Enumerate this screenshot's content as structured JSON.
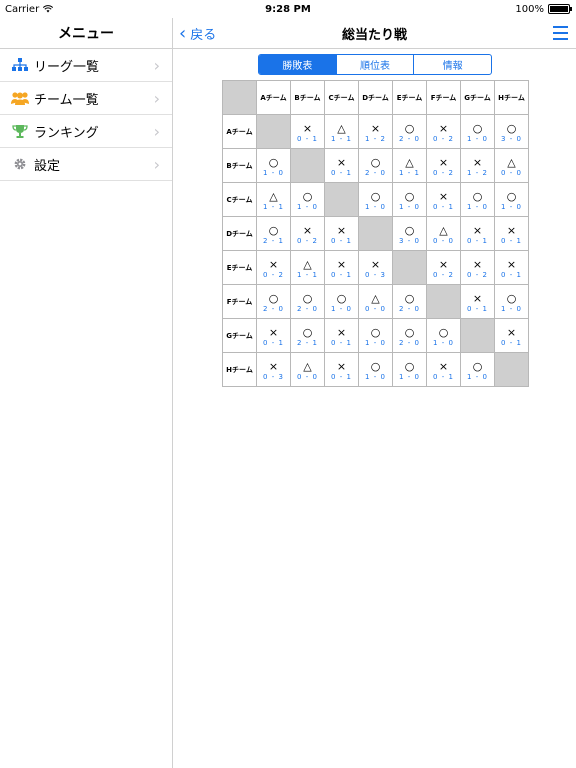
{
  "status_bar": {
    "carrier": "Carrier",
    "time": "9:28 PM",
    "battery": "100%"
  },
  "sidebar": {
    "title": "メニュー",
    "items": [
      {
        "label": "リーグ一覧",
        "icon": "hierarchy-icon",
        "color": "#1a73e8"
      },
      {
        "label": "チーム一覧",
        "icon": "people-icon",
        "color": "#f5a623"
      },
      {
        "label": "ランキング",
        "icon": "trophy-icon",
        "color": "#5cb85c"
      },
      {
        "label": "設定",
        "icon": "gear-icon",
        "color": "#8e8e93"
      }
    ]
  },
  "header": {
    "back_label": "戻る",
    "title": "総当たり戦"
  },
  "tabs": [
    {
      "label": "勝敗表",
      "active": true
    },
    {
      "label": "順位表",
      "active": false
    },
    {
      "label": "情報",
      "active": false
    }
  ],
  "teams": [
    "Aチーム",
    "Bチーム",
    "Cチーム",
    "Dチーム",
    "Eチーム",
    "Fチーム",
    "Gチーム",
    "Hチーム"
  ],
  "results": [
    [
      null,
      {
        "s": "×",
        "score": "0 - 1"
      },
      {
        "s": "△",
        "score": "1 - 1"
      },
      {
        "s": "×",
        "score": "1 - 2"
      },
      {
        "s": "○",
        "score": "2 - 0"
      },
      {
        "s": "×",
        "score": "0 - 2"
      },
      {
        "s": "○",
        "score": "1 - 0"
      },
      {
        "s": "○",
        "score": "3 - 0"
      }
    ],
    [
      {
        "s": "○",
        "score": "1 - 0"
      },
      null,
      {
        "s": "×",
        "score": "0 - 1"
      },
      {
        "s": "○",
        "score": "2 - 0"
      },
      {
        "s": "△",
        "score": "1 - 1"
      },
      {
        "s": "×",
        "score": "0 - 2"
      },
      {
        "s": "×",
        "score": "1 - 2"
      },
      {
        "s": "△",
        "score": "0 - 0"
      }
    ],
    [
      {
        "s": "△",
        "score": "1 - 1"
      },
      {
        "s": "○",
        "score": "1 - 0"
      },
      null,
      {
        "s": "○",
        "score": "1 - 0"
      },
      {
        "s": "○",
        "score": "1 - 0"
      },
      {
        "s": "×",
        "score": "0 - 1"
      },
      {
        "s": "○",
        "score": "1 - 0"
      },
      {
        "s": "○",
        "score": "1 - 0"
      }
    ],
    [
      {
        "s": "○",
        "score": "2 - 1"
      },
      {
        "s": "×",
        "score": "0 - 2"
      },
      {
        "s": "×",
        "score": "0 - 1"
      },
      null,
      {
        "s": "○",
        "score": "3 - 0"
      },
      {
        "s": "△",
        "score": "0 - 0"
      },
      {
        "s": "×",
        "score": "0 - 1"
      },
      {
        "s": "×",
        "score": "0 - 1"
      }
    ],
    [
      {
        "s": "×",
        "score": "0 - 2"
      },
      {
        "s": "△",
        "score": "1 - 1"
      },
      {
        "s": "×",
        "score": "0 - 1"
      },
      {
        "s": "×",
        "score": "0 - 3"
      },
      null,
      {
        "s": "×",
        "score": "0 - 2"
      },
      {
        "s": "×",
        "score": "0 - 2"
      },
      {
        "s": "×",
        "score": "0 - 1"
      }
    ],
    [
      {
        "s": "○",
        "score": "2 - 0"
      },
      {
        "s": "○",
        "score": "2 - 0"
      },
      {
        "s": "○",
        "score": "1 - 0"
      },
      {
        "s": "△",
        "score": "0 - 0"
      },
      {
        "s": "○",
        "score": "2 - 0"
      },
      null,
      {
        "s": "×",
        "score": "0 - 1"
      },
      {
        "s": "○",
        "score": "1 - 0"
      }
    ],
    [
      {
        "s": "×",
        "score": "0 - 1"
      },
      {
        "s": "○",
        "score": "2 - 1"
      },
      {
        "s": "×",
        "score": "0 - 1"
      },
      {
        "s": "○",
        "score": "1 - 0"
      },
      {
        "s": "○",
        "score": "2 - 0"
      },
      {
        "s": "○",
        "score": "1 - 0"
      },
      null,
      {
        "s": "×",
        "score": "0 - 1"
      }
    ],
    [
      {
        "s": "×",
        "score": "0 - 3"
      },
      {
        "s": "△",
        "score": "0 - 0"
      },
      {
        "s": "×",
        "score": "0 - 1"
      },
      {
        "s": "○",
        "score": "1 - 0"
      },
      {
        "s": "○",
        "score": "1 - 0"
      },
      {
        "s": "×",
        "score": "0 - 1"
      },
      {
        "s": "○",
        "score": "1 - 0"
      },
      null
    ]
  ]
}
